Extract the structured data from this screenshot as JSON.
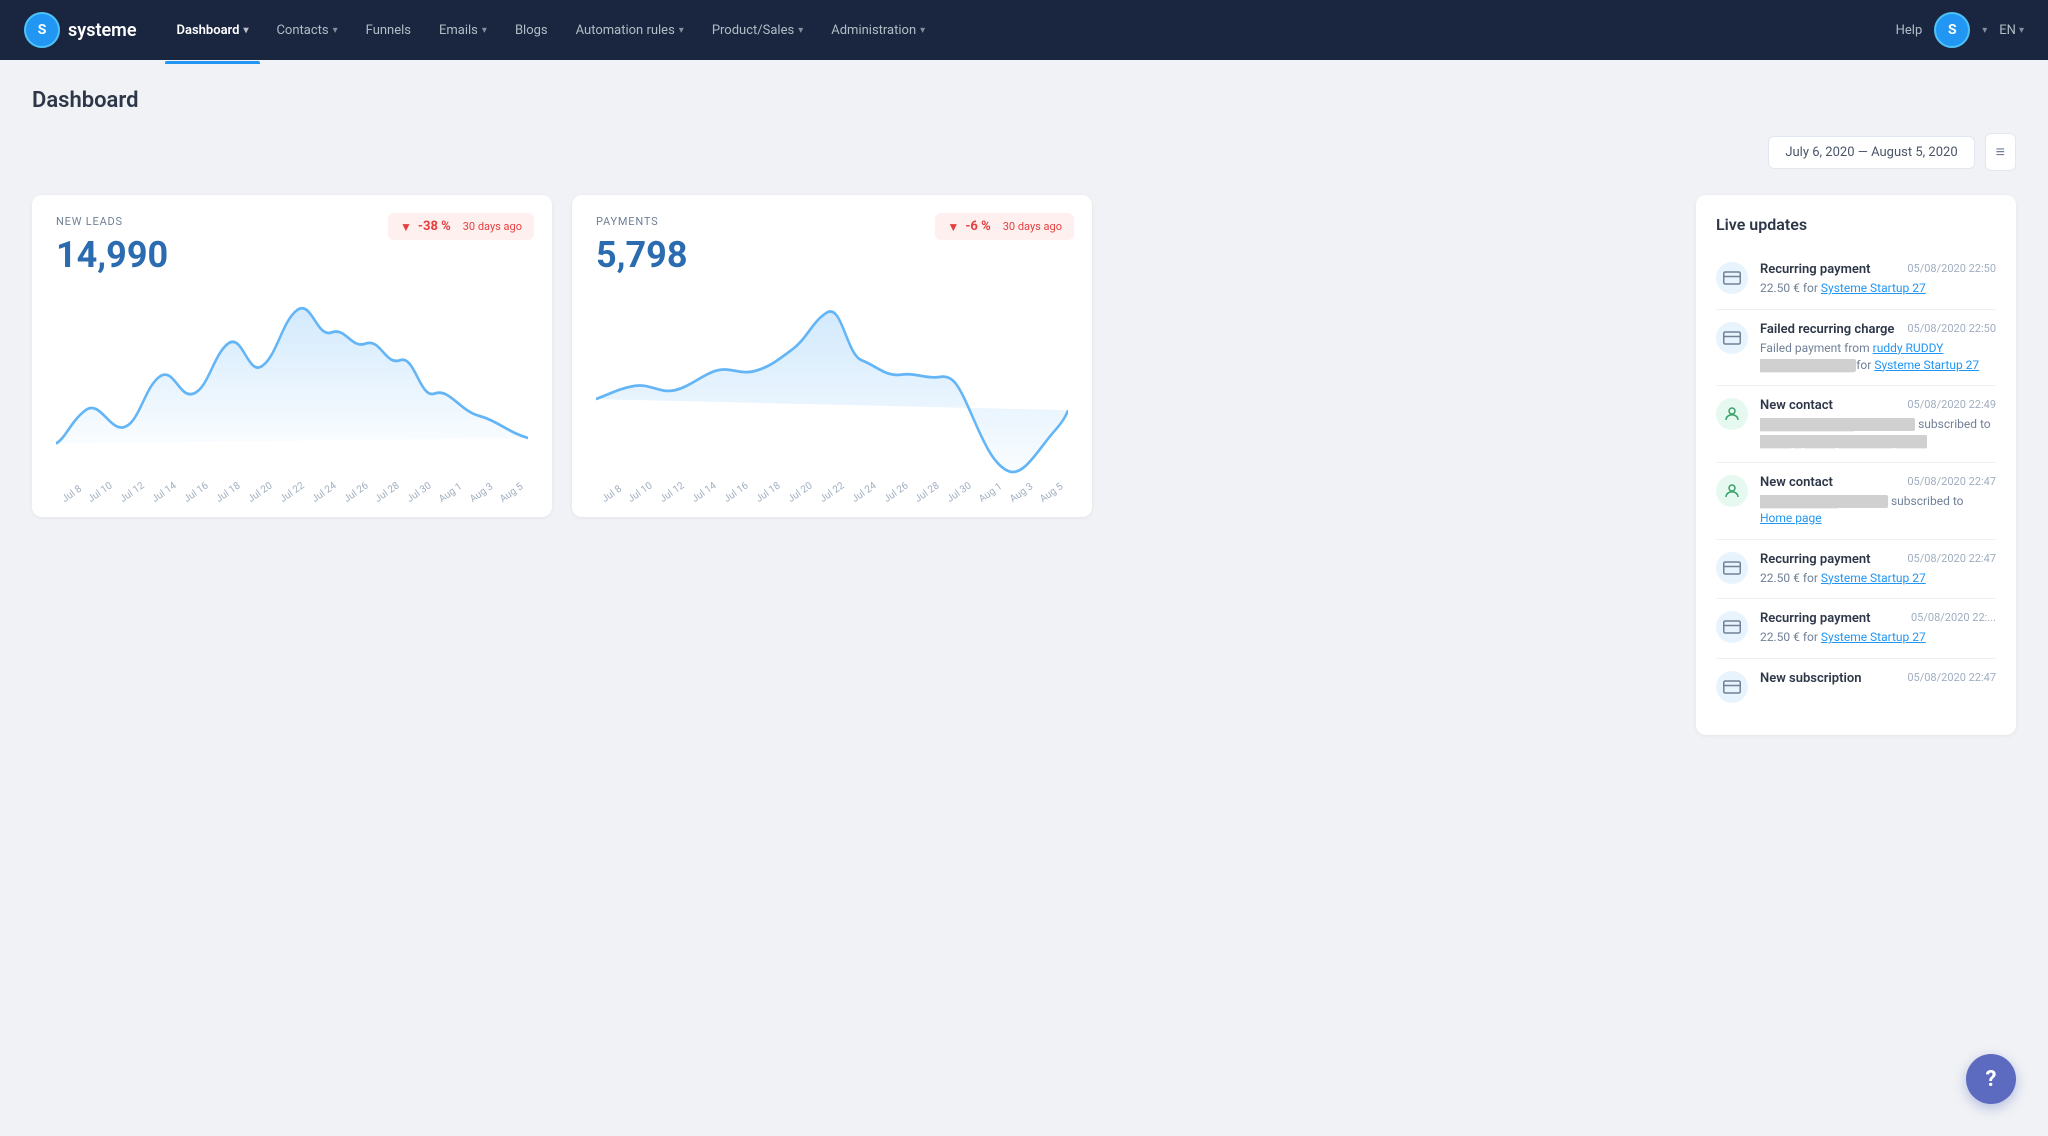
{
  "app": {
    "logo_letter": "S",
    "logo_text": "systeme"
  },
  "navbar": {
    "items": [
      {
        "id": "dashboard",
        "label": "Dashboard",
        "active": true,
        "has_dropdown": true
      },
      {
        "id": "contacts",
        "label": "Contacts",
        "active": false,
        "has_dropdown": true
      },
      {
        "id": "funnels",
        "label": "Funnels",
        "active": false,
        "has_dropdown": false
      },
      {
        "id": "emails",
        "label": "Emails",
        "active": false,
        "has_dropdown": true
      },
      {
        "id": "blogs",
        "label": "Blogs",
        "active": false,
        "has_dropdown": false
      },
      {
        "id": "automation",
        "label": "Automation rules",
        "active": false,
        "has_dropdown": true
      },
      {
        "id": "product_sales",
        "label": "Product/Sales",
        "active": false,
        "has_dropdown": true
      },
      {
        "id": "administration",
        "label": "Administration",
        "active": false,
        "has_dropdown": true
      }
    ],
    "help_label": "Help",
    "lang": "EN"
  },
  "page": {
    "title": "Dashboard"
  },
  "date_range": {
    "value": "July 6, 2020  —  August 5, 2020"
  },
  "new_leads": {
    "label": "NEW LEADS",
    "value": "14,990",
    "badge_value": "-38 %",
    "badge_sub": "30 days ago"
  },
  "payments": {
    "label": "PAYMENTS",
    "value": "5,798",
    "badge_value": "-6 %",
    "badge_sub": "30 days ago"
  },
  "x_labels_leads": [
    "Jul 8",
    "Jul 10",
    "Jul 12",
    "Jul 14",
    "Jul 16",
    "Jul 18",
    "Jul 20",
    "Jul 22",
    "Jul 24",
    "Jul 26",
    "Jul 28",
    "Jul 30",
    "Aug 1",
    "Aug 3",
    "Aug 5"
  ],
  "x_labels_payments": [
    "Jul 8",
    "Jul 10",
    "Jul 12",
    "Jul 14",
    "Jul 16",
    "Jul 18",
    "Jul 20",
    "Jul 22",
    "Jul 24",
    "Jul 26",
    "Jul 28",
    "Jul 30",
    "Aug 1",
    "Aug 3",
    "Aug 5"
  ],
  "live_updates": {
    "title": "Live updates",
    "items": [
      {
        "type": "payment",
        "icon": "💳",
        "icon_class": "",
        "title": "Recurring payment",
        "time": "05/08/2020 22:50",
        "desc": "22.50 € for",
        "link": "Systeme Startup 27"
      },
      {
        "type": "failed",
        "icon": "💳",
        "icon_class": "",
        "title": "Failed recurring charge",
        "time": "05/08/2020 22:50",
        "desc": "Failed payment from",
        "link_name": "ruddy RUDDY",
        "desc2": "for",
        "link2": "Systeme Startup 27"
      },
      {
        "type": "contact",
        "icon": "👤",
        "icon_class": "green",
        "title": "New contact",
        "time": "05/08/2020 22:49",
        "desc": "subscribed to",
        "link": "████ █ ████ ███████ ████"
      },
      {
        "type": "contact",
        "icon": "👤",
        "icon_class": "green",
        "title": "New contact",
        "time": "05/08/2020 22:47",
        "desc": "subscribed to",
        "link": "Home page"
      },
      {
        "type": "payment",
        "icon": "💳",
        "icon_class": "",
        "title": "Recurring payment",
        "time": "05/08/2020 22:47",
        "desc": "22.50 € for",
        "link": "Systeme Startup 27"
      },
      {
        "type": "payment",
        "icon": "💳",
        "icon_class": "",
        "title": "Recurring payment",
        "time": "05/08/2020 22:...",
        "desc": "22.50 € for",
        "link": "Systeme Startup 27"
      },
      {
        "type": "subscription",
        "icon": "💳",
        "icon_class": "",
        "title": "New subscription",
        "time": "05/08/2020 22:47",
        "desc": "",
        "link": ""
      }
    ]
  },
  "help_fab": {
    "label": "?"
  }
}
